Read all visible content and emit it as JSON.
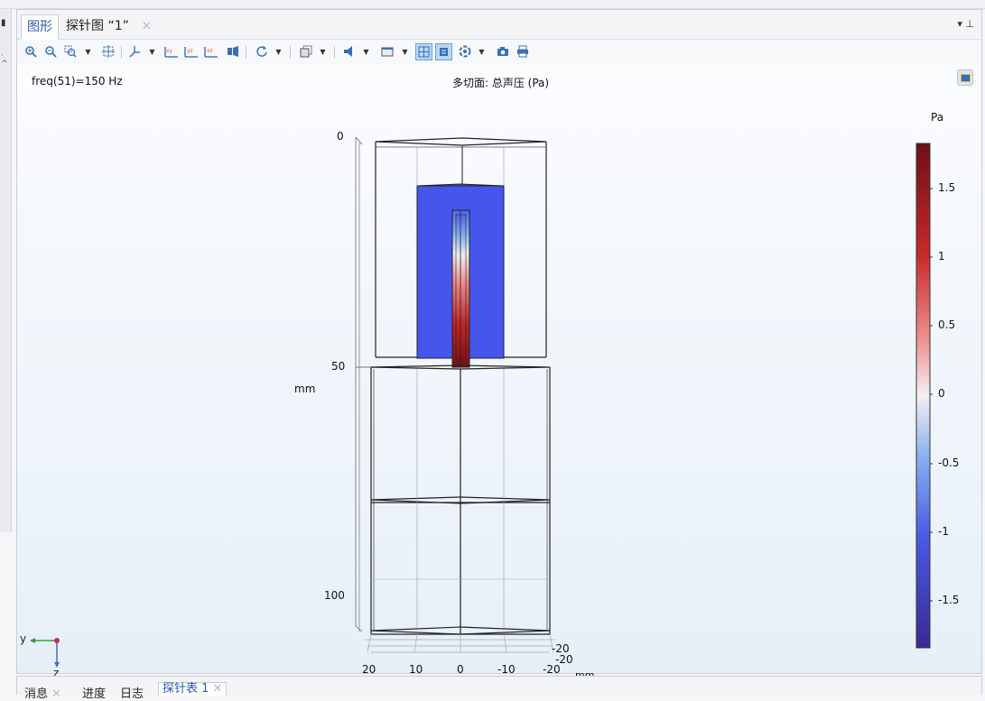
{
  "window": {
    "left_pin_icon": "pin-icon",
    "panel_controls": "▾ ⊥"
  },
  "tabs": [
    {
      "label": "图形",
      "active": true
    },
    {
      "label": "探针图 “1”",
      "active": false,
      "close": "✕"
    }
  ],
  "toolbar": {
    "icons": [
      "zoom-in-icon",
      "zoom-out-icon",
      "zoom-box-icon",
      "zoom-extents-icon",
      "axis-orientation-icon",
      "view-xy-icon",
      "view-yz-icon",
      "view-xz-icon",
      "go-to-view-icon",
      "rotate-icon",
      "selection-icon",
      "light-icon",
      "transparency-icon",
      "show-grid-icon",
      "show-axis-icon",
      "scene-light-icon",
      "screenshot-icon",
      "print-icon"
    ],
    "labels": {
      "xy": "xy",
      "yz": "yz",
      "xz": "xz"
    }
  },
  "plot": {
    "freq_label": "freq(51)=150 Hz",
    "title": "多切面: 总声压 (Pa)",
    "z_ticks": [
      "0",
      "50",
      "100"
    ],
    "z_unit": "mm",
    "y_ticks": [
      "20",
      "10",
      "0",
      "-10",
      "-20"
    ],
    "x_ticks": [
      "-20",
      "-20"
    ],
    "xy_unit": "mm",
    "triad": {
      "y": "y",
      "z": "z"
    }
  },
  "colorbar": {
    "unit": "Pa",
    "ticks": [
      "1.5",
      "1",
      "0.5",
      "0",
      "-0.5",
      "-1",
      "-1.5"
    ],
    "tick_values": [
      1.5,
      1,
      0.5,
      0,
      -0.5,
      -1,
      -1.5
    ],
    "range": [
      -1.85,
      1.85
    ],
    "colors": {
      "max": "#6e1019",
      "high": "#c52a2a",
      "mid": "#f4eef2",
      "low": "#4a5ae4",
      "min": "#3a2a90"
    }
  },
  "bottom_tabs": [
    {
      "label": "消息",
      "close": "✕"
    },
    {
      "label": "进度"
    },
    {
      "label": "日志"
    },
    {
      "label": "探针表 1",
      "close": "✕",
      "active": true
    }
  ]
}
